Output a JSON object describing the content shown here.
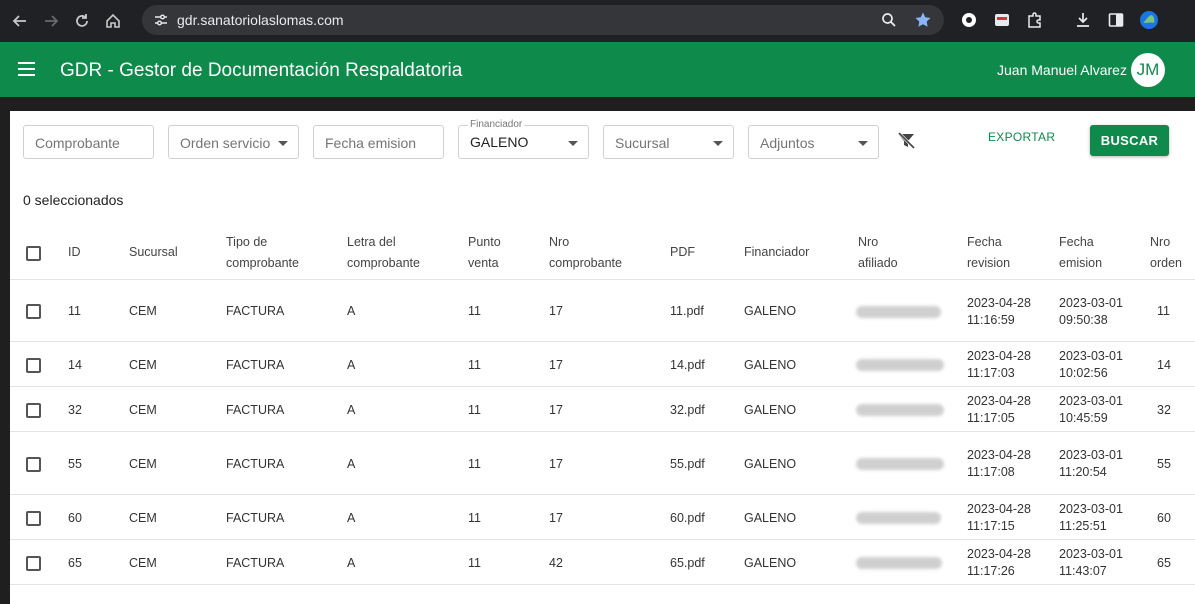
{
  "browser": {
    "url": "gdr.sanatoriolaslomas.com",
    "icons": [
      "back-icon",
      "forward-icon",
      "reload-icon",
      "home-icon",
      "site-settings-icon",
      "zoom-icon",
      "bookmark-star-icon",
      "extension-icon",
      "extensions-puzzle-icon",
      "download-icon",
      "side-panel-icon",
      "profile-icon"
    ]
  },
  "header": {
    "title": "GDR - Gestor de Documentación Respaldatoria",
    "user_name": "Juan Manuel Alvarez",
    "avatar_initials": "JM",
    "color": "#0e8a4b"
  },
  "filters": {
    "comprobante_placeholder": "Comprobante",
    "orden_servicio_placeholder": "Orden servicio",
    "fecha_emision_placeholder": "Fecha emision",
    "financiador_label": "Financiador",
    "financiador_value": "GALENO",
    "sucursal_placeholder": "Sucursal",
    "adjuntos_placeholder": "Adjuntos",
    "export_label": "EXPORTAR",
    "search_label": "BUSCAR"
  },
  "selection": {
    "count_text": "0 seleccionados"
  },
  "table": {
    "columns": {
      "id": "ID",
      "sucursal": "Sucursal",
      "tipo_1": "Tipo de",
      "tipo_2": "comprobante",
      "letra_1": "Letra del",
      "letra_2": "comprobante",
      "punto_1": "Punto",
      "punto_2": "venta",
      "nro_comp_1": "Nro",
      "nro_comp_2": "comprobante",
      "pdf": "PDF",
      "financiador": "Financiador",
      "afiliado_1": "Nro",
      "afiliado_2": "afiliado",
      "revision_1": "Fecha",
      "revision_2": "revision",
      "emision_1": "Fecha",
      "emision_2": "emision",
      "orden_1": "Nro",
      "orden_2": "orden"
    },
    "rows": [
      {
        "id": "11",
        "sucursal": "CEM",
        "tipo": "FACTURA",
        "letra": "A",
        "punto": "11",
        "nro": "17",
        "pdf": "11.pdf",
        "financiador": "GALENO",
        "rev_date": "2023-04-28",
        "rev_time": "11:16:59",
        "em_date": "2023-03-01",
        "em_time": "09:50:38",
        "orden": "11"
      },
      {
        "id": "14",
        "sucursal": "CEM",
        "tipo": "FACTURA",
        "letra": "A",
        "punto": "11",
        "nro": "17",
        "pdf": "14.pdf",
        "financiador": "GALENO",
        "rev_date": "2023-04-28",
        "rev_time": "11:17:03",
        "em_date": "2023-03-01",
        "em_time": "10:02:56",
        "orden": "14"
      },
      {
        "id": "32",
        "sucursal": "CEM",
        "tipo": "FACTURA",
        "letra": "A",
        "punto": "11",
        "nro": "17",
        "pdf": "32.pdf",
        "financiador": "GALENO",
        "rev_date": "2023-04-28",
        "rev_time": "11:17:05",
        "em_date": "2023-03-01",
        "em_time": "10:45:59",
        "orden": "32"
      },
      {
        "id": "55",
        "sucursal": "CEM",
        "tipo": "FACTURA",
        "letra": "A",
        "punto": "11",
        "nro": "17",
        "pdf": "55.pdf",
        "financiador": "GALENO",
        "rev_date": "2023-04-28",
        "rev_time": "11:17:08",
        "em_date": "2023-03-01",
        "em_time": "11:20:54",
        "orden": "55"
      },
      {
        "id": "60",
        "sucursal": "CEM",
        "tipo": "FACTURA",
        "letra": "A",
        "punto": "11",
        "nro": "17",
        "pdf": "60.pdf",
        "financiador": "GALENO",
        "rev_date": "2023-04-28",
        "rev_time": "11:17:15",
        "em_date": "2023-03-01",
        "em_time": "11:25:51",
        "orden": "60"
      },
      {
        "id": "65",
        "sucursal": "CEM",
        "tipo": "FACTURA",
        "letra": "A",
        "punto": "11",
        "nro": "42",
        "pdf": "65.pdf",
        "financiador": "GALENO",
        "rev_date": "2023-04-28",
        "rev_time": "11:17:26",
        "em_date": "2023-03-01",
        "em_time": "11:43:07",
        "orden": "65"
      }
    ]
  }
}
